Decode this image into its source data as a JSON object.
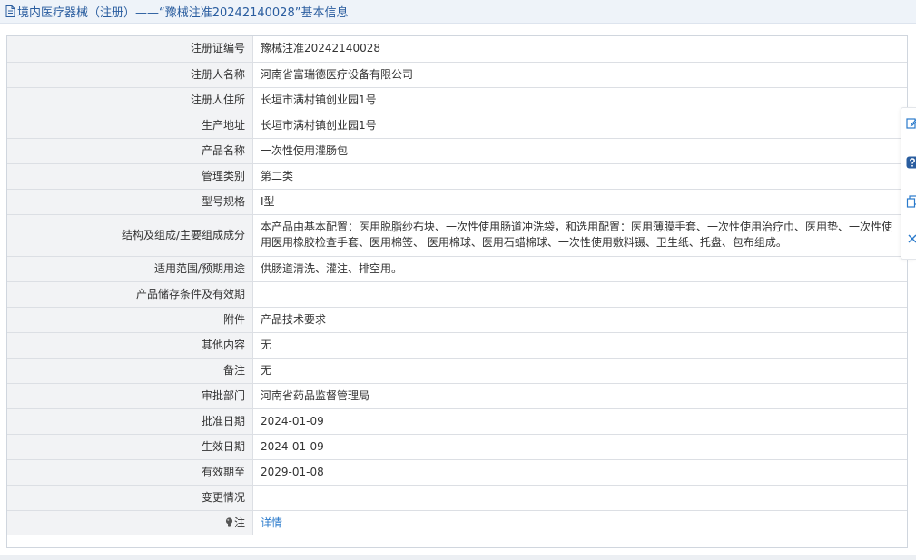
{
  "header": {
    "title": "境内医疗器械（注册）——“豫械注准20242140028”基本信息",
    "icon": "document-icon"
  },
  "rows": [
    {
      "label": "注册证编号",
      "value": "豫械注准20242140028"
    },
    {
      "label": "注册人名称",
      "value": "河南省富瑞德医疗设备有限公司"
    },
    {
      "label": "注册人住所",
      "value": "长垣市满村镇创业园1号"
    },
    {
      "label": "生产地址",
      "value": "长垣市满村镇创业园1号"
    },
    {
      "label": "产品名称",
      "value": "一次性使用灌肠包"
    },
    {
      "label": "管理类别",
      "value": "第二类"
    },
    {
      "label": "型号规格",
      "value": "I型"
    },
    {
      "label": "结构及组成/主要组成成分",
      "value": "本产品由基本配置：医用脱脂纱布块、一次性使用肠道冲洗袋，和选用配置：医用薄膜手套、一次性使用治疗巾、医用垫、一次性使用医用橡胶检查手套、医用棉签、 医用棉球、医用石蜡棉球、一次性使用敷料镊、卫生纸、托盘、包布组成。"
    },
    {
      "label": "适用范围/预期用途",
      "value": "供肠道清洗、灌注、排空用。"
    },
    {
      "label": "产品储存条件及有效期",
      "value": ""
    },
    {
      "label": "附件",
      "value": "产品技术要求"
    },
    {
      "label": "其他内容",
      "value": "无"
    },
    {
      "label": "备注",
      "value": "无"
    },
    {
      "label": "审批部门",
      "value": "河南省药品监督管理局"
    },
    {
      "label": "批准日期",
      "value": "2024-01-09"
    },
    {
      "label": "生效日期",
      "value": "2024-01-09"
    },
    {
      "label": "有效期至",
      "value": "2029-01-08"
    },
    {
      "label": "变更情况",
      "value": ""
    },
    {
      "label": "注",
      "value": "详情",
      "icon": "lightbulb-icon"
    }
  ],
  "side_tools": [
    "edit-icon",
    "help-icon",
    "copy-icon",
    "close-icon"
  ],
  "colors": {
    "header_text": "#2a5d9f",
    "header_bg": "#eef3f9",
    "label_bg": "#f2f3f5",
    "link": "#2a7acb",
    "tool_blue": "#2a7acb"
  }
}
